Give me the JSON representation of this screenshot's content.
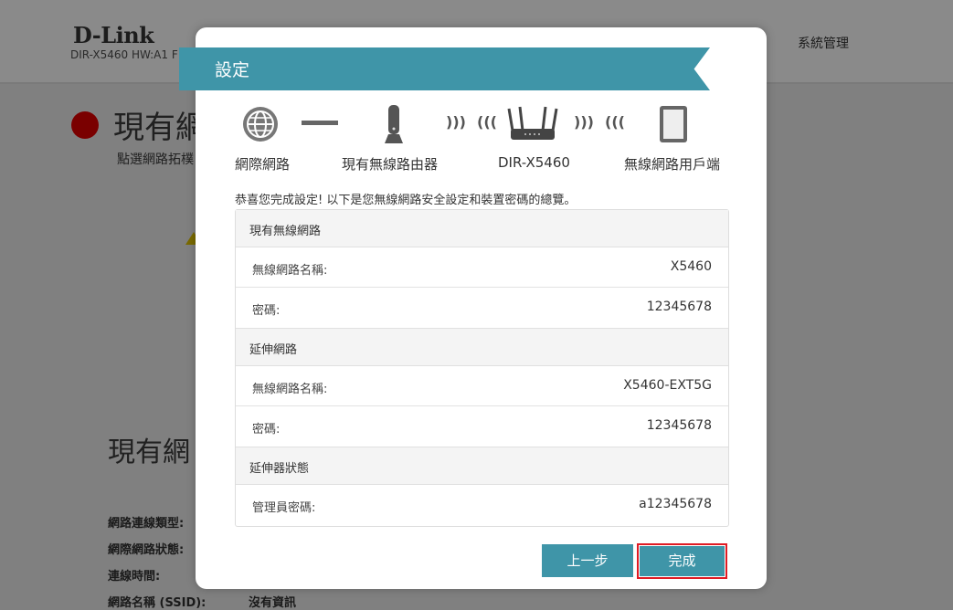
{
  "background": {
    "logo": "D-Link",
    "model_text": "DIR-X5460 HW:A1 F",
    "nav_item": "系統管理",
    "page_heading": "現有網",
    "page_subtext": "點選網路拓樸",
    "section_heading": "現有網",
    "info_labels": [
      "網路連線類型:",
      "網際網路狀態:",
      "連線時間:",
      "網路名稱 (SSID):"
    ],
    "info_value_ssid": "沒有資訊"
  },
  "modal": {
    "title": "設定",
    "topology": {
      "internet_label": "網際網路",
      "extender_label": "現有無線路由器",
      "router_label": "DIR-X5460",
      "client_label": "無線網路用戶端"
    },
    "summary_text": "恭喜您完成設定! 以下是您無線網路安全設定和裝置密碼的總覽。",
    "sections": [
      {
        "header": "現有無線網路",
        "rows": [
          {
            "label": "無線網路名稱:",
            "value": "X5460"
          },
          {
            "label": "密碼:",
            "value": "12345678"
          }
        ]
      },
      {
        "header": "延伸網路",
        "rows": [
          {
            "label": "無線網路名稱:",
            "value": "X5460-EXT5G"
          },
          {
            "label": "密碼:",
            "value": "12345678"
          }
        ]
      },
      {
        "header": "延伸器狀態",
        "rows": [
          {
            "label": "管理員密碼:",
            "value": "a12345678"
          }
        ]
      }
    ],
    "back_button": "上一步",
    "finish_button": "完成"
  },
  "colors": {
    "accent": "#3f95a8",
    "highlight_outline": "#e01b24",
    "overlay": "#808080"
  }
}
